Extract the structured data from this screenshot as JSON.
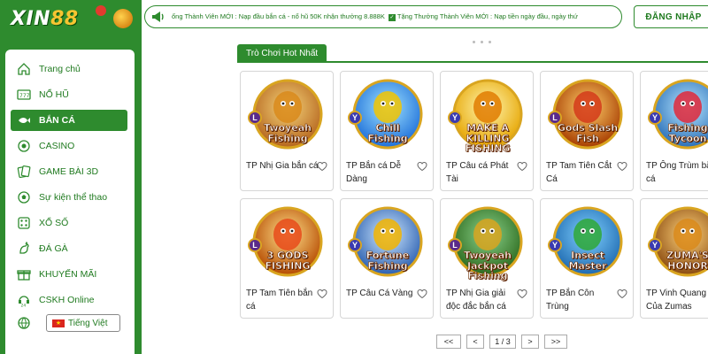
{
  "brand": {
    "logo_word": "XIN",
    "logo_num": "88"
  },
  "sidebar": {
    "items": [
      {
        "label": "Trang chủ",
        "icon": "home-icon",
        "active": false
      },
      {
        "label": "NỔ HŨ",
        "icon": "slot-machine-icon",
        "active": false
      },
      {
        "label": "BẮN CÁ",
        "icon": "fish-icon",
        "active": true
      },
      {
        "label": "CASINO",
        "icon": "casino-chip-icon",
        "active": false
      },
      {
        "label": "GAME BÀI 3D",
        "icon": "cards-icon",
        "active": false
      },
      {
        "label": "Sự kiện thể thao",
        "icon": "soccer-ball-icon",
        "active": false
      },
      {
        "label": "XỔ SỐ",
        "icon": "lottery-icon",
        "active": false
      },
      {
        "label": "ĐÁ GÀ",
        "icon": "rooster-icon",
        "active": false
      },
      {
        "label": "KHUYẾN MÃI",
        "icon": "gift-icon",
        "active": false
      },
      {
        "label": "CSKH Online",
        "icon": "support-24-icon",
        "active": false
      }
    ],
    "language": "Tiếng Việt"
  },
  "announcement": {
    "part1": "ổng Thành Viên MỚI : Nạp đầu bắn cá - nổ hũ 50K nhận thưởng 8.888K",
    "part2": "Tặng Thưởng Thành Viên MỚI : Nạp tiền ngày đầu, ngày thứ"
  },
  "header": {
    "login_label": "ĐĂNG NHẬP"
  },
  "section": {
    "title": "Trò Chơi Hot Nhất"
  },
  "games": [
    {
      "caption": "TP Nhị Gia bắn cá",
      "logo_line1": "Twoyeah",
      "logo_line2": "Fishing",
      "badge": "L",
      "bg1": "#f4d37a",
      "bg2": "#b5651d",
      "fg": "#d98a1b"
    },
    {
      "caption": "TP Bắn cá Dễ Dàng",
      "logo_line1": "Chill",
      "logo_line2": "Fishing",
      "badge": "Y",
      "bg1": "#9fe3ff",
      "bg2": "#1e6fd9",
      "fg": "#f2c400"
    },
    {
      "caption": "TP Câu cá Phát Tài",
      "logo_line1": "MAKE A",
      "logo_line2": "KILLING FISHING",
      "badge": "Y",
      "bg1": "#fff6b0",
      "bg2": "#e6a400",
      "fg": "#e07b00"
    },
    {
      "caption": "TP Tam Tiên Cắt Cá",
      "logo_line1": "Gods Slash",
      "logo_line2": "Fish",
      "badge": "L",
      "bg1": "#ffcf6a",
      "bg2": "#a63c00",
      "fg": "#d43a1a"
    },
    {
      "caption": "TP Ông Trùm bắn cá",
      "logo_line1": "Fishing",
      "logo_line2": "Tycoon",
      "badge": "Y",
      "bg1": "#b6e6ff",
      "bg2": "#2a6fb8",
      "fg": "#e0283a"
    },
    {
      "caption": "TP Tam Tiên bắn cá",
      "logo_line1": "3 GODS",
      "logo_line2": "FISHING",
      "badge": "L",
      "bg1": "#ffe08a",
      "bg2": "#b54a00",
      "fg": "#e84a1a"
    },
    {
      "caption": "TP Câu Cá Vàng",
      "logo_line1": "Fortune",
      "logo_line2": "Fishing",
      "badge": "Y",
      "bg1": "#cfe9ff",
      "bg2": "#2b5fb0",
      "fg": "#f2b400"
    },
    {
      "caption": "TP Nhị Gia giải độc đắc bắn cá",
      "logo_line1": "Twoyeah",
      "logo_line2": "Jackpot Fishing",
      "badge": "L",
      "bg1": "#8ad18a",
      "bg2": "#2c6a1e",
      "fg": "#d9a520"
    },
    {
      "caption": "TP Bắn Côn Trùng",
      "logo_line1": "Insect",
      "logo_line2": "Master",
      "badge": "Y",
      "bg1": "#7fd0ff",
      "bg2": "#1f6ab0",
      "fg": "#2fa836"
    },
    {
      "caption": "TP Vinh Quang Của Zumas",
      "logo_line1": "ZUMA'S",
      "logo_line2": "HONOR",
      "badge": "Y",
      "bg1": "#ffd37a",
      "bg2": "#8a4a10",
      "fg": "#d98a1b"
    }
  ],
  "pagination": {
    "first": "<<",
    "prev": "<",
    "page": "1 / 3",
    "next": ">",
    "last": ">>"
  },
  "colors": {
    "brand_green": "#2e8b2e",
    "text_green": "#1f7a1f"
  }
}
